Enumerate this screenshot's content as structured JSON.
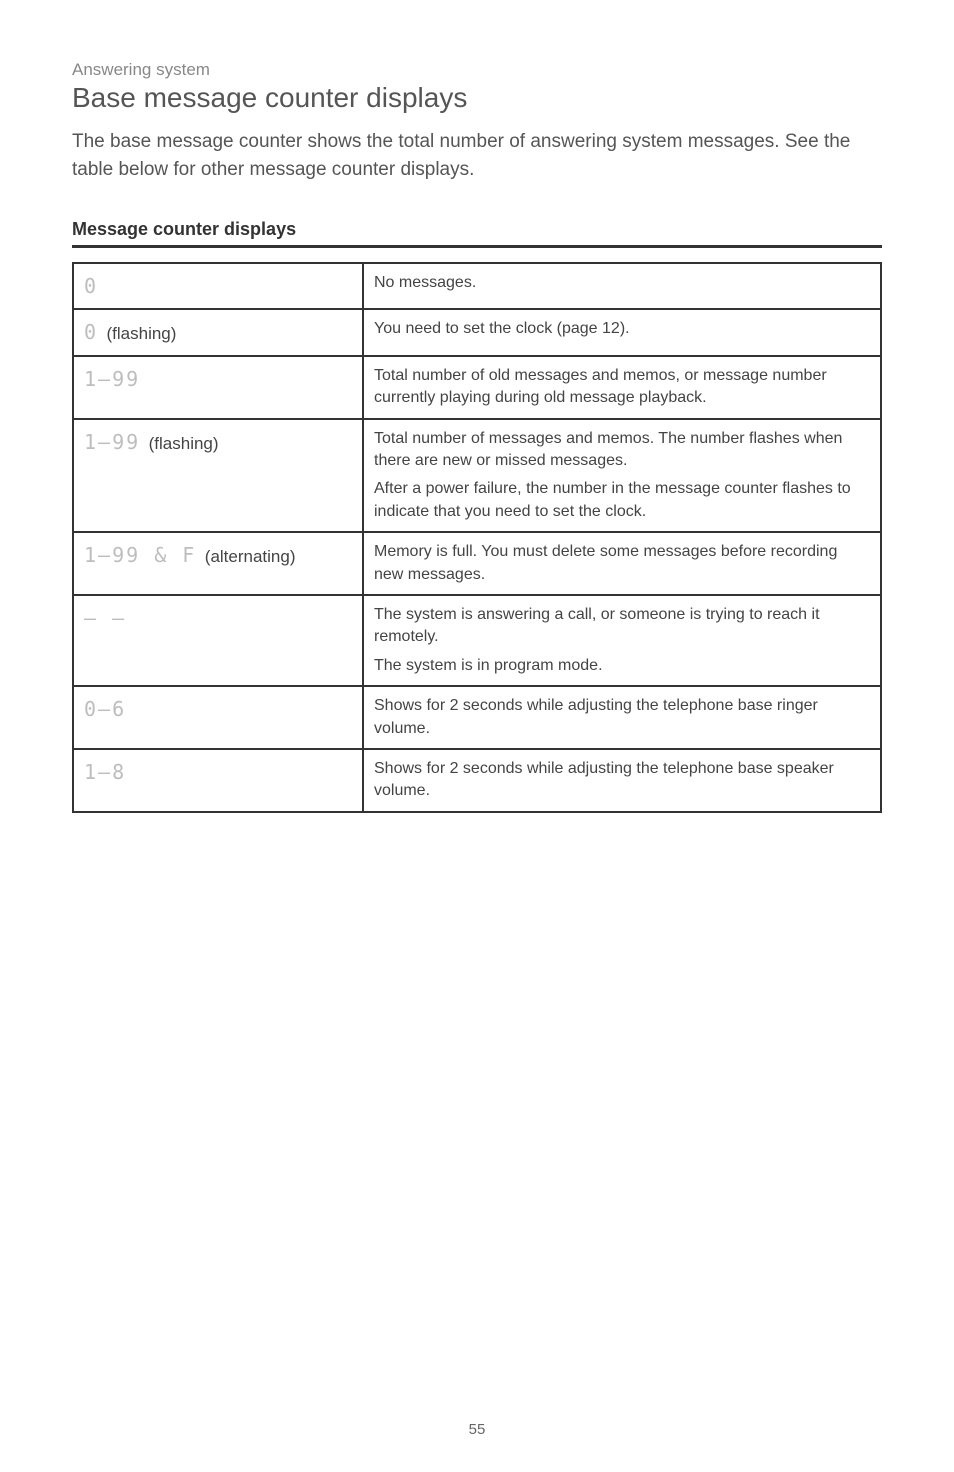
{
  "breadcrumb": "Answering system",
  "page_title": "Base message counter displays",
  "intro": "The base message counter shows the total number of answering system messages. See the table below for other message counter displays.",
  "table_heading": "Message counter displays",
  "rows": [
    {
      "digit": "0",
      "suffix": "",
      "desc1": "No messages.",
      "desc2": ""
    },
    {
      "digit": "0",
      "suffix": "(flashing)",
      "desc1": "You need to set the clock (page 12).",
      "desc2": ""
    },
    {
      "digit": "1–99",
      "suffix": "",
      "desc1": "Total number of old messages and memos, or message number currently playing during old message playback.",
      "desc2": ""
    },
    {
      "digit": "1–99",
      "suffix": "(flashing)",
      "desc1": "Total number of messages and memos. The number flashes when there are new or missed messages.",
      "desc2": "After a power failure, the number in the message counter flashes to indicate that you need to set the clock."
    },
    {
      "digit": "1–99 & F",
      "suffix": "(alternating)",
      "desc1": "Memory is full. You must delete some messages before recording new messages.",
      "desc2": ""
    },
    {
      "digit": "– –",
      "suffix": "",
      "desc1": "The system is answering a call, or someone is trying to reach it remotely.",
      "desc2": "The system is in program mode."
    },
    {
      "digit": "0–6",
      "suffix": "",
      "desc1": "Shows for 2 seconds while adjusting the telephone base ringer volume.",
      "desc2": ""
    },
    {
      "digit": "1–8",
      "suffix": "",
      "desc1": "Shows for 2 seconds while adjusting the telephone base speaker volume.",
      "desc2": ""
    }
  ],
  "page_number": "55"
}
